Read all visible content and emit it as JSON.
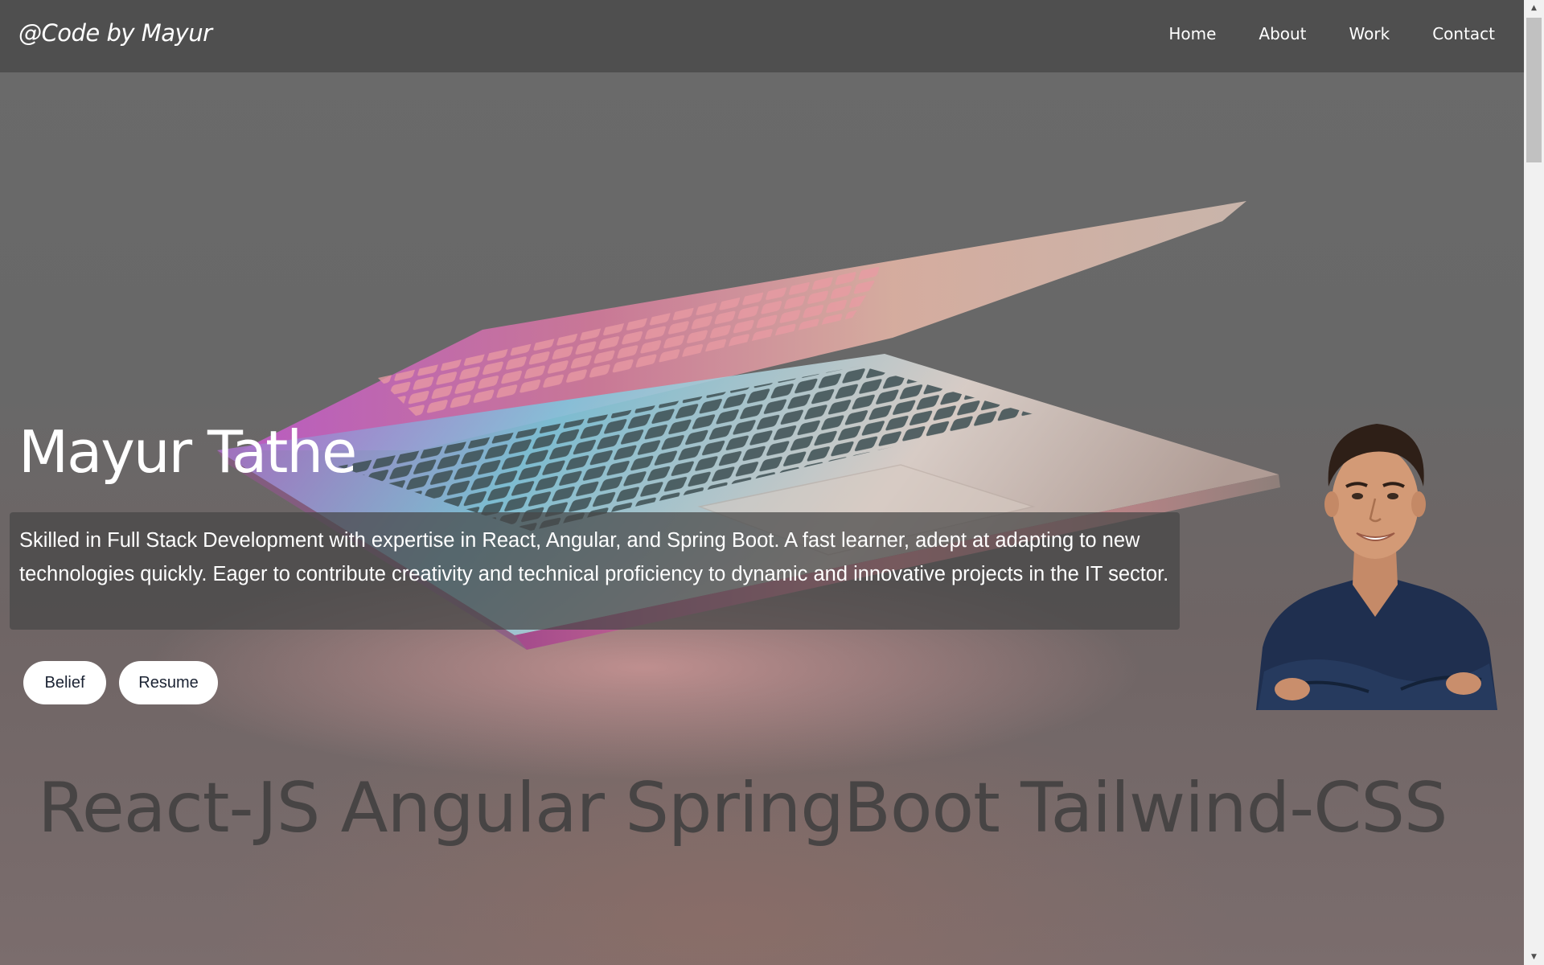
{
  "navbar": {
    "brand": "@Code by Mayur",
    "links": [
      {
        "label": "Home"
      },
      {
        "label": "About"
      },
      {
        "label": "Work"
      },
      {
        "label": "Contact"
      }
    ]
  },
  "hero": {
    "name": "Mayur Tathe",
    "description": "Skilled in Full Stack Development with expertise in React, Angular, and Spring Boot. A fast learner, adept at adapting to new technologies quickly. Eager to contribute creativity and technical proficiency to dynamic and innovative projects in the IT sector.",
    "buttons": {
      "belief": "Belief",
      "resume": "Resume"
    }
  },
  "skills": {
    "text": "React-JS Angular SpringBoot Tailwind-CSS"
  },
  "colors": {
    "navbar_bg": "#484848",
    "page_bg": "#6b6b6b",
    "skills_text": "#474444",
    "button_bg": "#ffffff",
    "button_text": "#1b2333"
  },
  "icons": {
    "scroll_up": "scroll-up-arrow-icon",
    "scroll_down": "scroll-down-arrow-icon"
  }
}
